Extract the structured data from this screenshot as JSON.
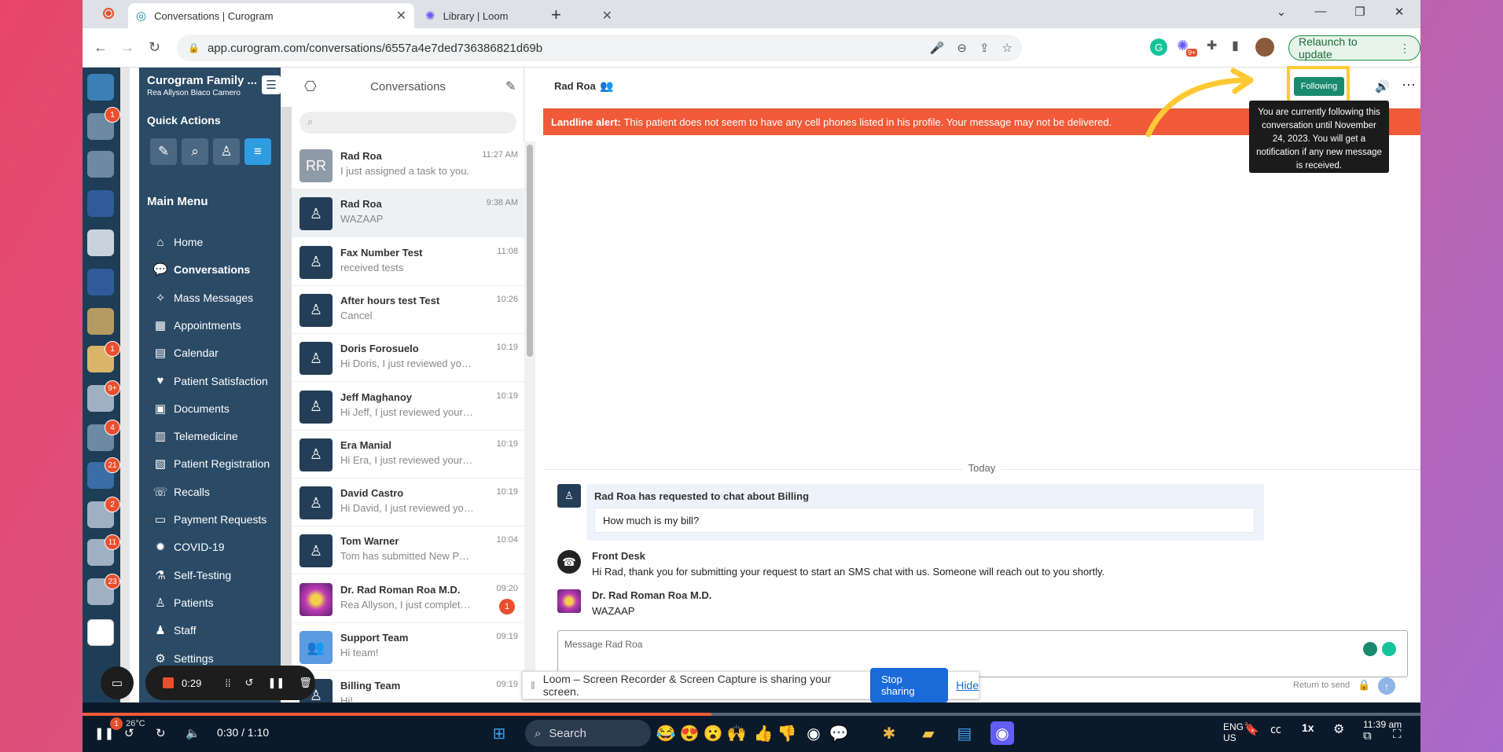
{
  "browser": {
    "tabs": [
      {
        "label": "Conversations | Curogram",
        "icon": "curogram-icon"
      },
      {
        "label": "Library | Loom",
        "icon": "loom-icon"
      }
    ],
    "url": "app.curogram.com/conversations/6557a4e7ded736386821d69b",
    "relaunch_label": "Relaunch to update",
    "extension_badge": "9+"
  },
  "rail": {
    "badges": [
      "1",
      "9+",
      "9+",
      "4",
      "21",
      "2",
      "11",
      "23",
      "1"
    ]
  },
  "menu": {
    "org_name": "Curogram Family ...",
    "user_name": "Rea Allyson Biaco Camero",
    "quick_actions_title": "Quick Actions",
    "main_menu_title": "Main Menu",
    "items": [
      {
        "label": "Home",
        "icon": "home-icon"
      },
      {
        "label": "Conversations",
        "icon": "chat-icon"
      },
      {
        "label": "Mass Messages",
        "icon": "broadcast-icon"
      },
      {
        "label": "Appointments",
        "icon": "appointments-icon"
      },
      {
        "label": "Calendar",
        "icon": "calendar-icon"
      },
      {
        "label": "Patient Satisfaction",
        "icon": "heart-icon"
      },
      {
        "label": "Documents",
        "icon": "documents-icon"
      },
      {
        "label": "Telemedicine",
        "icon": "telemedicine-icon"
      },
      {
        "label": "Patient Registration",
        "icon": "registration-icon"
      },
      {
        "label": "Recalls",
        "icon": "phone-icon"
      },
      {
        "label": "Payment Requests",
        "icon": "card-icon"
      },
      {
        "label": "COVID-19",
        "icon": "virus-icon"
      },
      {
        "label": "Self-Testing",
        "icon": "flask-icon"
      },
      {
        "label": "Patients",
        "icon": "patient-icon"
      },
      {
        "label": "Staff",
        "icon": "staff-icon"
      },
      {
        "label": "Settings",
        "icon": "gear-icon"
      }
    ],
    "selected": "Conversations"
  },
  "conversations": {
    "title": "Conversations",
    "items": [
      {
        "name": "Rad Roa",
        "preview": "I just assigned a task to you.",
        "time": "11:27 AM",
        "avatar": "RR"
      },
      {
        "name": "Rad Roa",
        "preview": "WAZAAP",
        "time": "9:38 AM",
        "avatar": ""
      },
      {
        "name": "Fax Number Test",
        "preview": "received tests",
        "time": "11:08",
        "avatar": ""
      },
      {
        "name": "After hours test Test",
        "preview": "Cancel",
        "time": "10:26",
        "avatar": ""
      },
      {
        "name": "Doris Forosuelo",
        "preview": "Hi Doris, I just reviewed you...",
        "time": "10:19",
        "avatar": ""
      },
      {
        "name": "Jeff Maghanoy",
        "preview": "Hi Jeff, I just reviewed your ...",
        "time": "10:19",
        "avatar": ""
      },
      {
        "name": "Era Manial",
        "preview": "Hi Era, I just reviewed your a...",
        "time": "10:19",
        "avatar": ""
      },
      {
        "name": "David Castro",
        "preview": "Hi David, I just reviewed you...",
        "time": "10:19",
        "avatar": ""
      },
      {
        "name": "Tom Warner",
        "preview": "Tom has submitted New Pati...",
        "time": "10:04",
        "avatar": ""
      },
      {
        "name": "Dr. Rad Roman Roa M.D.",
        "preview": "Rea Allyson, I just completed...",
        "time": "09:20",
        "avatar": "",
        "badge": "1"
      },
      {
        "name": "Support Team",
        "preview": "Hi team!",
        "time": "09:19",
        "avatar": ""
      },
      {
        "name": "Billing Team",
        "preview": "Hi!",
        "time": "09:19",
        "avatar": ""
      }
    ]
  },
  "chat": {
    "contact": "Rad Roa",
    "follow_label": "Following",
    "tooltip": "You are currently following this conversation until November 24, 2023. You will get a notification if any new message is received.",
    "alert_bold": "Landline alert:",
    "alert_text": "This patient does not seem to have any cell phones listed in his profile. Your message may not be delivered.",
    "day_divider": "Today",
    "request_title": "Rad Roa has requested to chat about Billing",
    "request_message": "How much is my bill?",
    "messages": [
      {
        "sender": "Front Desk",
        "text": "Hi Rad, thank you for submitting your request to start an SMS chat with us. Someone will reach out to you shortly."
      },
      {
        "sender": "Dr. Rad Roman Roa M.D.",
        "text": "WAZAAP"
      }
    ],
    "input_placeholder": "Message Rad Roa",
    "return_to_send": "Return to send"
  },
  "loom": {
    "share_text": "Loom – Screen Recorder & Screen Capture is sharing your screen.",
    "stop_label": "Stop sharing",
    "hide_label": "Hide",
    "timer": "0:29"
  },
  "video": {
    "time": "0:30 / 1:10",
    "progress": 0.47,
    "speed": "1x"
  },
  "taskbar": {
    "search_label": "Search",
    "weather": "26°C",
    "lang": "ENG",
    "region": "US",
    "clock": "11:39 am",
    "notif_badge": "1"
  }
}
